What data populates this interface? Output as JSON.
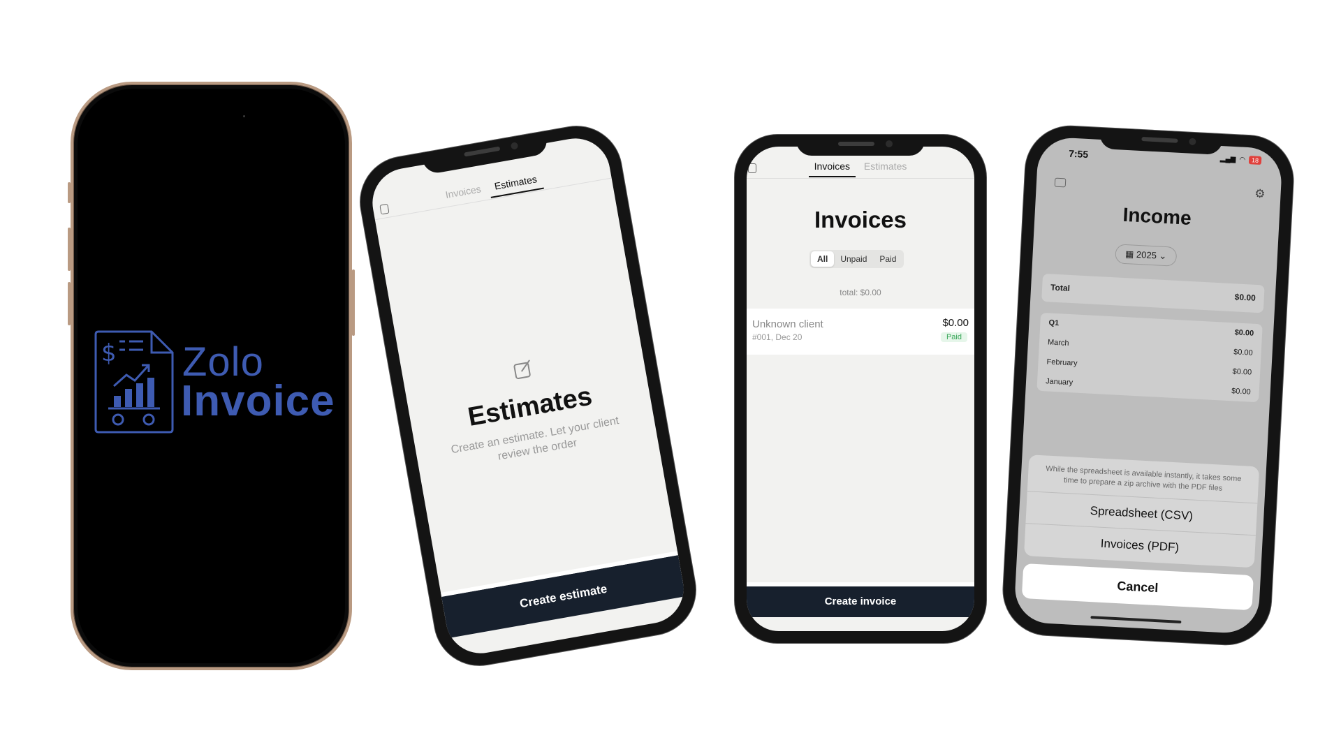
{
  "splash": {
    "brand_line1": "Zolo",
    "brand_line2": "Invoice",
    "brand_color": "#3e5bb2"
  },
  "estimates_screen": {
    "tabs": [
      "Invoices",
      "Estimates"
    ],
    "active_tab": "Estimates",
    "icon": "edit-icon",
    "title": "Estimates",
    "subtitle": "Create an estimate. Let your client review the order",
    "cta": "Create estimate"
  },
  "invoices_screen": {
    "tabs": [
      "Invoices",
      "Estimates"
    ],
    "active_tab": "Invoices",
    "title": "Invoices",
    "filters": [
      "All",
      "Unpaid",
      "Paid"
    ],
    "active_filter": "All",
    "total_label": "total:",
    "total_value": "$0.00",
    "rows": [
      {
        "client": "Unknown client",
        "meta": "#001, Dec 20",
        "amount": "$0.00",
        "status": "Paid"
      }
    ],
    "cta": "Create invoice"
  },
  "income_screen": {
    "status_time": "7:55",
    "battery": "18",
    "title": "Income",
    "year": "2025",
    "total_label": "Total",
    "total_value": "$0.00",
    "quarters": [
      {
        "label": "Q1",
        "value": "$0.00",
        "months": [
          {
            "label": "March",
            "value": "$0.00"
          },
          {
            "label": "February",
            "value": "$0.00"
          },
          {
            "label": "January",
            "value": "$0.00"
          }
        ]
      }
    ],
    "sheet": {
      "note": "While the spreadsheet is available instantly, it takes some time to prepare a zip archive with the PDF files",
      "options": [
        "Spreadsheet (CSV)",
        "Invoices (PDF)"
      ],
      "cancel": "Cancel"
    }
  },
  "colors": {
    "dark_button": "#17202d",
    "paid_green": "#3aa75a",
    "screen_bg": "#f2f2f0"
  }
}
